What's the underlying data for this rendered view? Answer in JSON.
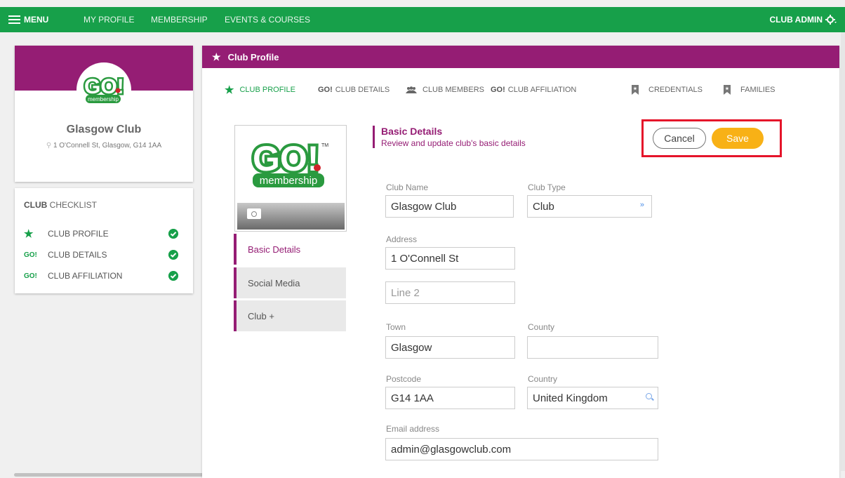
{
  "nav": {
    "menu_label": "MENU",
    "links": [
      "MY PROFILE",
      "MEMBERSHIP",
      "EVENTS & COURSES"
    ],
    "admin_label": "CLUB ADMIN"
  },
  "club": {
    "name": "Glasgow Club",
    "address": "1 O'Connell St, Glasgow, G14 1AA",
    "logo_text": "GO!",
    "logo_sub": "membership",
    "logo_tm": "TM"
  },
  "checklist": {
    "title_bold": "CLUB",
    "title_rest": " CHECKLIST",
    "items": [
      {
        "icon": "star",
        "label": "CLUB PROFILE"
      },
      {
        "icon": "GO!",
        "label": "CLUB DETAILS"
      },
      {
        "icon": "GO!",
        "label": "CLUB AFFILIATION"
      }
    ]
  },
  "panel": {
    "title": "Club Profile",
    "tabs": [
      {
        "icon": "★",
        "label": "CLUB PROFILE"
      },
      {
        "icon": "GO!",
        "label": "CLUB DETAILS"
      },
      {
        "icon": "people",
        "label": "CLUB MEMBERS"
      },
      {
        "icon": "GO!",
        "label": "CLUB AFFILIATION"
      },
      {
        "icon": "bookmark",
        "label": "CREDENTIALS"
      },
      {
        "icon": "bookmark",
        "label": "FAMILIES"
      }
    ],
    "side_nav": [
      "Basic Details",
      "Social Media",
      "Club +"
    ],
    "section_title": "Basic Details",
    "section_subtitle": "Review and update club's basic details",
    "cancel_label": "Cancel",
    "save_label": "Save"
  },
  "form": {
    "club_name_label": "Club Name",
    "club_name": "Glasgow Club",
    "club_type_label": "Club Type",
    "club_type": "Club",
    "address_label": "Address",
    "address_line1": "1 O'Connell St",
    "address_line2_placeholder": "Line 2",
    "town_label": "Town",
    "town": "Glasgow",
    "county_label": "County",
    "county": "",
    "postcode_label": "Postcode",
    "postcode": "G14 1AA",
    "country_label": "Country",
    "country": "United Kingdom",
    "email_label": "Email address",
    "email": "admin@glasgowclub.com"
  },
  "colors": {
    "green": "#17a04a",
    "purple": "#951d74",
    "save": "#f8b116",
    "highlight": "#e5142a"
  }
}
